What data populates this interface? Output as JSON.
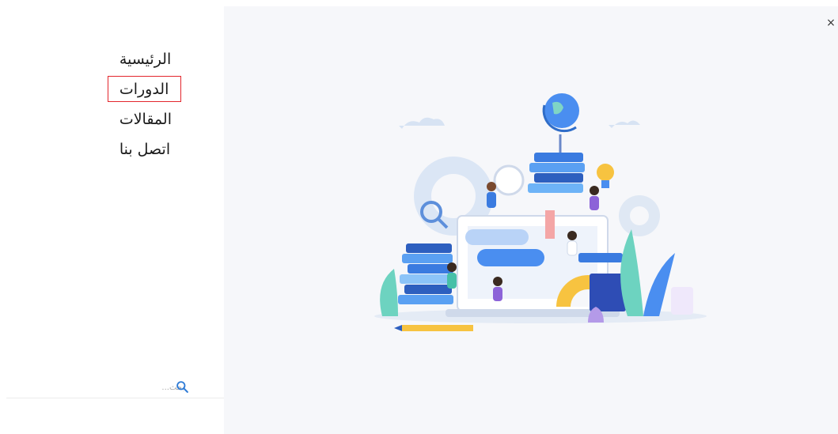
{
  "nav": {
    "items": [
      {
        "label": "الرئيسية",
        "active": false
      },
      {
        "label": "الدورات",
        "active": true
      },
      {
        "label": "المقالات",
        "active": false
      },
      {
        "label": "اتصل بنا",
        "active": false
      }
    ]
  },
  "search": {
    "placeholder": "بحث...",
    "icon": "search-icon"
  },
  "close": {
    "label": "×"
  },
  "colors": {
    "active_highlight": "#e3262c",
    "panel_bg": "#f6f7fa",
    "accent_blue": "#4a8ef0"
  }
}
